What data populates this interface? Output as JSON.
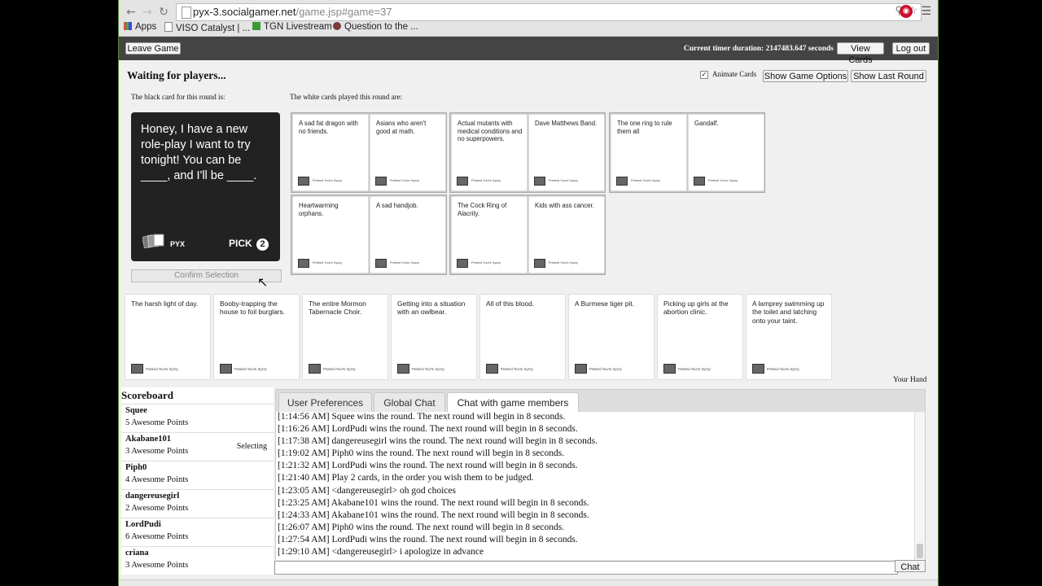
{
  "browser": {
    "url_host": "pyx-3.socialgamer.net",
    "url_path": "/game.jsp#game=37",
    "bookmarks": [
      "Apps",
      "VISO Catalyst | ...",
      "TGN Livestream",
      "Question to the ..."
    ]
  },
  "topbar": {
    "leave_label": "Leave Game",
    "timer_text": "Current timer duration: 2147483.647 seconds",
    "view_cards_label": "View Cards",
    "logout_label": "Log out"
  },
  "game": {
    "status": "Waiting for players...",
    "animate_label": "Animate Cards",
    "show_options_label": "Show Game Options",
    "show_last_round_label": "Show Last Round",
    "black_card_heading": "The black card for this round is:",
    "white_cards_heading": "The white cards played this round are:",
    "black_card_text": "Honey, I have a new role-play I want to try tonight! You can be ____, and I'll be ____.",
    "black_card_brand": "PYX",
    "pick_label": "PICK",
    "pick_count": "2",
    "confirm_label": "Confirm Selection"
  },
  "played": [
    [
      "A sad fat dragon with no friends.",
      "Asians who aren't good at math."
    ],
    [
      "Actual mutants with medical conditions and no superpowers.",
      "Dave Matthews Band."
    ],
    [
      "The one ring to rule them all",
      "Gandalf."
    ],
    [
      "Heartwarming orphans.",
      "A sad handjob."
    ],
    [
      "The Cock Ring of Alacrity.",
      "Kids with ass cancer."
    ]
  ],
  "card_footer": "Pretend You're Xyzzy",
  "hand": [
    "The harsh light of day.",
    "Booby-trapping the house to foil burglars.",
    "The entire Mormon Tabernacle Choir.",
    "Getting into a situation with an owlbear.",
    "All of this blood.",
    "A Burmese tiger pit.",
    "Picking up girls at the abortion clinic.",
    "A lamprey swimming up the toilet and latching onto your taint."
  ],
  "your_hand_label": "Your Hand",
  "scoreboard": {
    "title": "Scoreboard",
    "players": [
      {
        "name": "Squee",
        "points": "5 Awesome Points",
        "status": ""
      },
      {
        "name": "Akabane101",
        "points": "3 Awesome Points",
        "status": "Selecting"
      },
      {
        "name": "Piph0",
        "points": "4 Awesome Points",
        "status": ""
      },
      {
        "name": "dangereusegirl",
        "points": "2 Awesome Points",
        "status": ""
      },
      {
        "name": "LordPudi",
        "points": "6 Awesome Points",
        "status": ""
      },
      {
        "name": "criana",
        "points": "3 Awesome Points",
        "status": ""
      }
    ]
  },
  "chat": {
    "tabs": [
      "User Preferences",
      "Global Chat",
      "Chat with game members"
    ],
    "lines": [
      "[1:14:56 AM] Squee wins the round. The next round will begin in 8 seconds.",
      "[1:16:26 AM] LordPudi wins the round. The next round will begin in 8 seconds.",
      "[1:17:38 AM] dangereusegirl wins the round. The next round will begin in 8 seconds.",
      "[1:19:02 AM] Piph0 wins the round. The next round will begin in 8 seconds.",
      "[1:21:32 AM] LordPudi wins the round. The next round will begin in 8 seconds.",
      "[1:21:40 AM] Play 2 cards, in the order you wish them to be judged.",
      "[1:23:05 AM] <dangereusegirl> oh god choices",
      "[1:23:25 AM] Akabane101 wins the round. The next round will begin in 8 seconds.",
      "[1:24:33 AM] Akabane101 wins the round. The next round will begin in 8 seconds.",
      "[1:26:07 AM] Piph0 wins the round. The next round will begin in 8 seconds.",
      "[1:27:54 AM] LordPudi wins the round. The next round will begin in 8 seconds.",
      "[1:29:10 AM] <dangereusegirl> i apologize in advance"
    ],
    "send_label": "Chat"
  }
}
